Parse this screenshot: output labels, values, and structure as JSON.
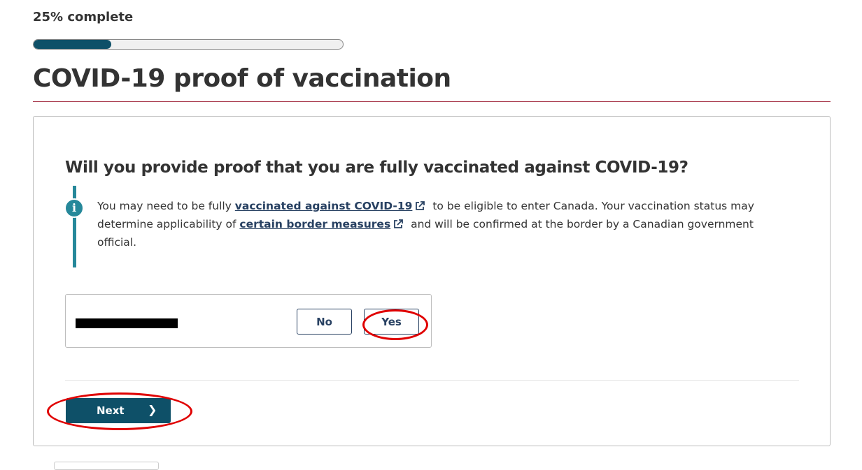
{
  "progress": {
    "label": "25% complete",
    "value_percent": 25
  },
  "page": {
    "title": "COVID-19 proof of vaccination"
  },
  "question": {
    "title": "Will you provide proof that you are fully vaccinated against COVID-19?",
    "info": {
      "icon": "info-icon",
      "text_1": "You may need to be fully ",
      "link_1": "vaccinated against COVID-19",
      "text_2": " to be eligible to enter Canada. Your vaccination status may determine applicability of ",
      "link_2": "certain border measures",
      "text_3": " and will be confirmed at the border by a Canadian government official."
    },
    "options": {
      "no_label": "No",
      "yes_label": "Yes"
    }
  },
  "actions": {
    "next_label": "Next",
    "next_icon": "chevron-right-icon"
  },
  "colors": {
    "primary": "#0e5068",
    "link": "#284162",
    "info": "#26889a",
    "rule": "#a8384c",
    "annotation": "#e00000"
  }
}
